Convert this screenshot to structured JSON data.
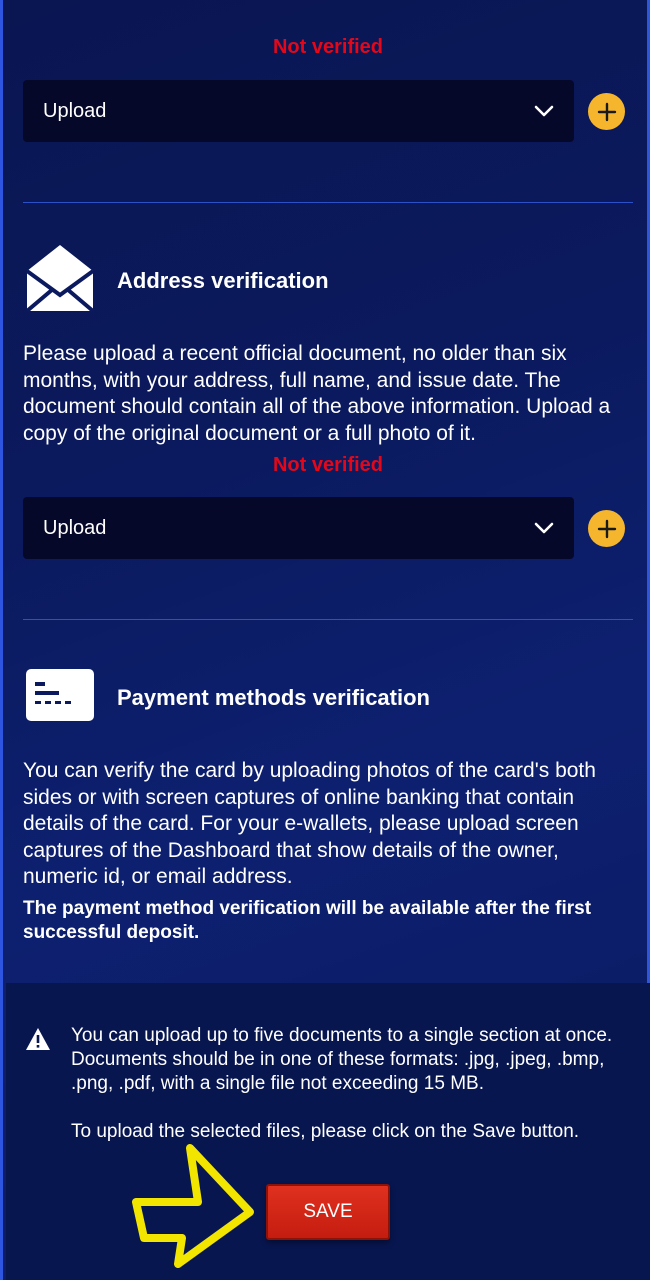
{
  "identity": {
    "status": "Not verified",
    "select_value": "Upload"
  },
  "address": {
    "title": "Address verification",
    "description": "Please upload a recent official document, no older than six months, with your address, full name, and issue date. The document should contain all of the above information. Upload a copy of the original document or a full photo of it.",
    "status": "Not verified",
    "select_value": "Upload"
  },
  "payment": {
    "title": "Payment methods verification",
    "description": "You can verify the card by uploading photos of the card's both sides or with screen captures of online banking that contain details of the card. For your e-wallets, please upload screen captures of the Dashboard that show details of the owner, numeric id, or email address.",
    "note": "The payment method verification will be available after the first successful deposit."
  },
  "info": {
    "paragraph1": "You can upload up to five documents to a single section at once. Documents should be in one of these formats: .jpg, .jpeg, .bmp, .png, .pdf, with a single file not exceeding 15 MB.",
    "paragraph2": "To upload the selected files, please click on the Save button."
  },
  "save_label": "SAVE",
  "colors": {
    "background": "#0b1a5e",
    "status_red": "#e3071a",
    "accent_yellow": "#f5b62d",
    "save_red": "#d0281a",
    "highlight_arrow": "#f2e600"
  },
  "icons": {
    "envelope": "envelope-open-icon",
    "card": "card-icon",
    "plus": "plus-icon",
    "chevron": "chevron-down-icon",
    "warning": "warning-icon",
    "arrow": "highlight-arrow-icon"
  }
}
